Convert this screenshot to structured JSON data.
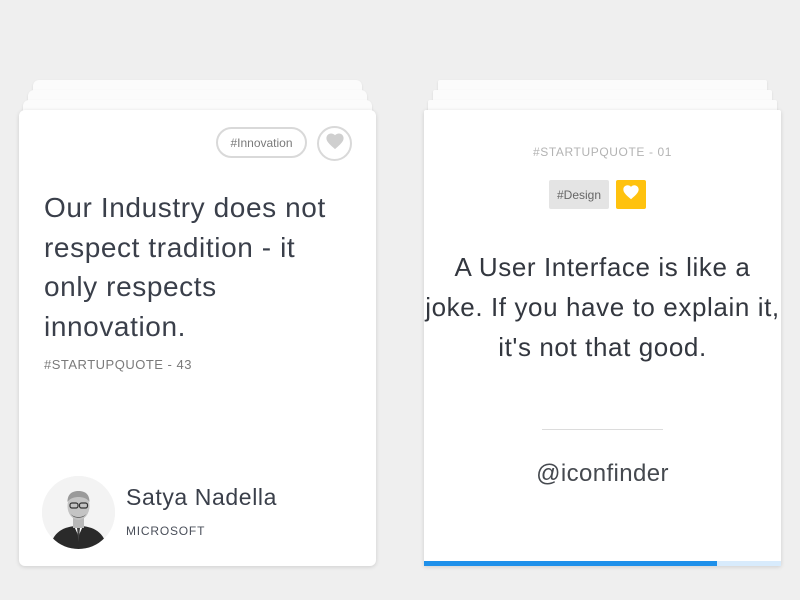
{
  "colors": {
    "background": "#efefef",
    "accent_yellow": "#ffc20e",
    "progress_blue": "#1e90ea",
    "progress_track": "#d8ebfc"
  },
  "left_card": {
    "tag": "#Innovation",
    "like_icon": "heart-icon",
    "quote": "Our Industry does not respect tradition - it only respects innovation.",
    "meta": "#STARTUPQUOTE - 43",
    "author": {
      "name": "Satya Nadella",
      "company": "MICROSOFT"
    }
  },
  "right_card": {
    "meta": "#STARTUPQUOTE - 01",
    "tag": "#Design",
    "like_icon": "heart-icon",
    "quote": "A User Interface is like a joke. If you have to explain it, it's not that good.",
    "handle": "@iconfinder",
    "progress": 0.82
  }
}
